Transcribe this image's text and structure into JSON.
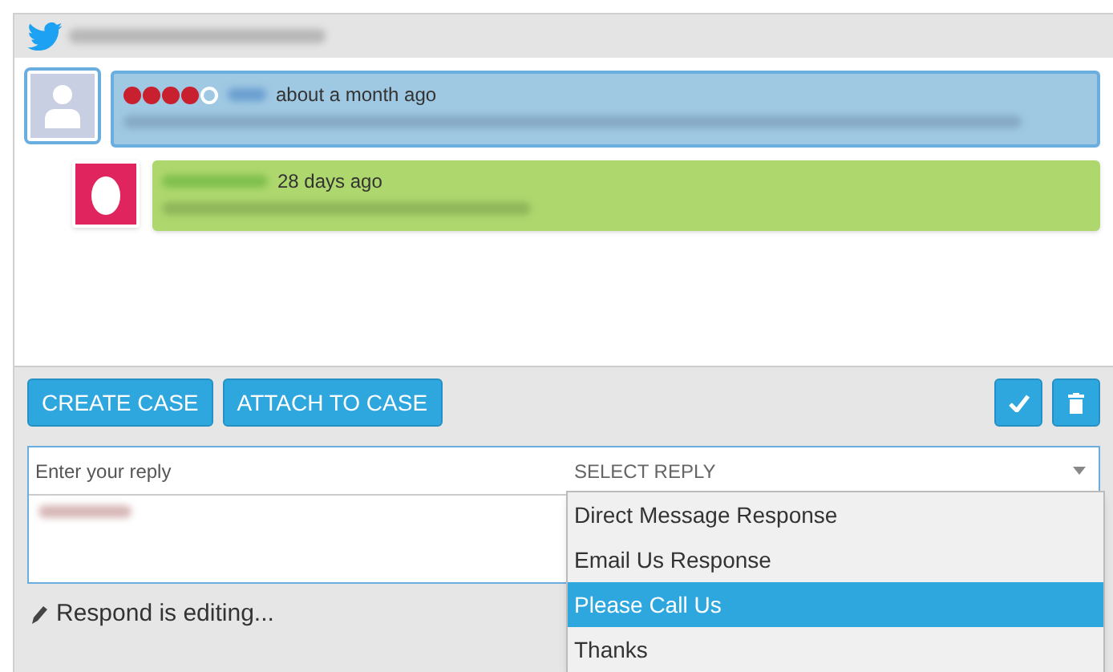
{
  "messages": [
    {
      "kind": "incoming",
      "stars": 4,
      "time": "about a month ago"
    },
    {
      "kind": "reply",
      "time": "28 days ago"
    }
  ],
  "actions": [
    "CREATE CASE",
    "ATTACH TO CASE"
  ],
  "reply": {
    "placeholder": "Enter your reply",
    "select_label": "SELECT REPLY",
    "options": [
      {
        "label": "Direct Message Response",
        "selected": false
      },
      {
        "label": "Email Us Response",
        "selected": false
      },
      {
        "label": "Please Call Us",
        "selected": true
      },
      {
        "label": "Thanks",
        "selected": false
      }
    ]
  },
  "status": "Respond is editing..."
}
